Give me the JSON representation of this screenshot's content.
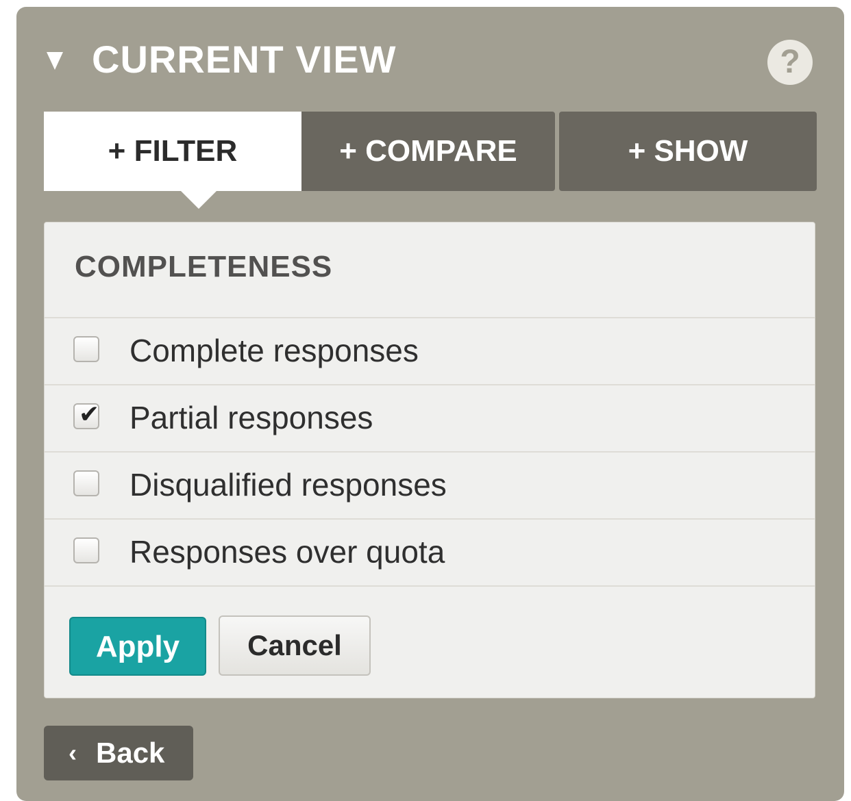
{
  "header": {
    "title": "CURRENT VIEW",
    "collapse_icon": "triangle-down-icon",
    "help_icon": "question-mark-icon",
    "help_glyph": "?"
  },
  "tabs": [
    {
      "label": "+ FILTER",
      "active": true
    },
    {
      "label": "+ COMPARE",
      "active": false
    },
    {
      "label": "+ SHOW",
      "active": false
    }
  ],
  "filter": {
    "section_title": "COMPLETENESS",
    "options": [
      {
        "label": "Complete responses",
        "checked": false
      },
      {
        "label": "Partial responses",
        "checked": true
      },
      {
        "label": "Disqualified responses",
        "checked": false
      },
      {
        "label": "Responses over quota",
        "checked": false
      }
    ],
    "apply_label": "Apply",
    "cancel_label": "Cancel"
  },
  "footer": {
    "back_label": "Back",
    "back_icon": "chevron-left-icon",
    "back_glyph": "‹"
  },
  "colors": {
    "panel_bg": "#a29f92",
    "tab_inactive_bg": "#6a675f",
    "apply_bg": "#1aa3a3",
    "back_bg": "#605e57"
  }
}
